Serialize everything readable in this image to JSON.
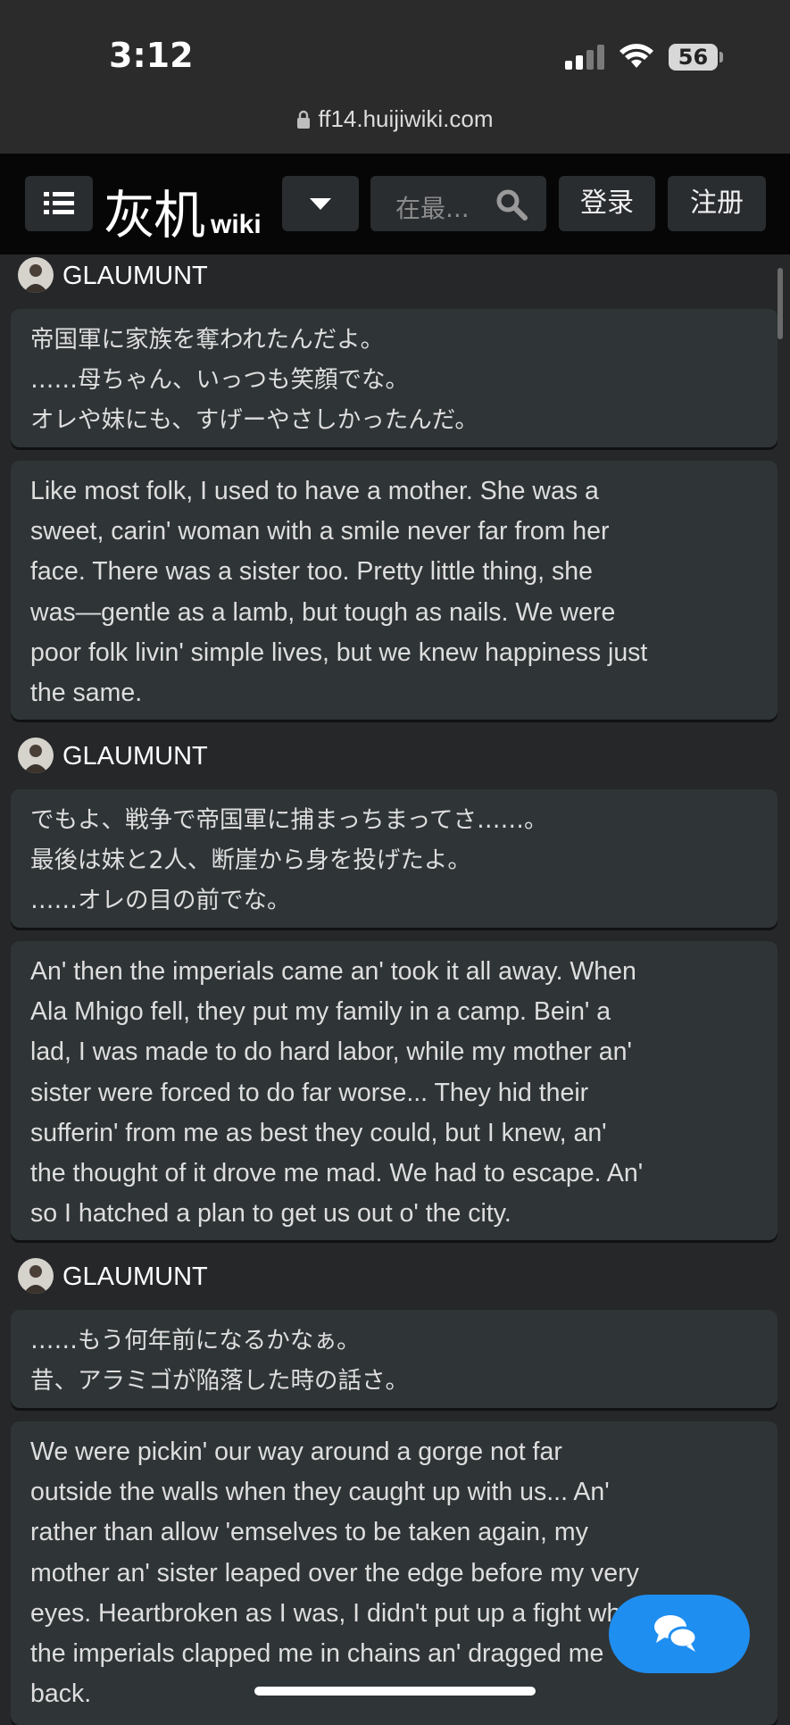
{
  "status": {
    "time": "3:12",
    "battery": "56",
    "url": "ff14.huijiwiki.com"
  },
  "header": {
    "logo_cn": "灰机",
    "logo_wiki": "wiki",
    "search_placeholder": "在最...",
    "login_label": "登录",
    "register_label": "注册"
  },
  "dialogue": [
    {
      "speaker": "GLAUMUNT",
      "jp_lines": [
        "帝国軍に家族を奪われたんだよ。",
        "……母ちゃん、いっつも笑顔でな。",
        "オレや妹にも、すげーやさしかったんだ。"
      ],
      "en_lines": [
        "Like most folk, I used to have a mother. She was a",
        "sweet, carin' woman with a smile never far from her",
        "face. There was a sister too. Pretty little thing, she",
        "was—gentle as a lamb, but tough as nails. We were",
        "poor folk livin' simple lives, but we knew happiness just",
        "the same."
      ]
    },
    {
      "speaker": "GLAUMUNT",
      "jp_lines": [
        "でもよ、戦争で帝国軍に捕まっちまってさ……。",
        "最後は妹と2人、断崖から身を投げたよ。",
        "……オレの目の前でな。"
      ],
      "en_lines": [
        "An' then the imperials came an' took it all away. When",
        "Ala Mhigo fell, they put my family in a camp. Bein' a",
        "lad, I was made to do hard labor, while my mother an'",
        "sister were forced to do far worse... They hid their",
        "sufferin' from me as best they could, but I knew, an'",
        "the thought of it drove me mad. We had to escape. An'",
        "so I hatched a plan to get us out o' the city."
      ]
    },
    {
      "speaker": "GLAUMUNT",
      "jp_lines": [
        "……もう何年前になるかなぁ。",
        "昔、アラミゴが陥落した時の話さ。"
      ],
      "en_lines": [
        "We were pickin' our way around a gorge not far",
        "outside the walls when they caught up with us... An'",
        "rather than allow 'emselves to be taken again, my",
        "mother an' sister leaped over the edge before my very",
        "eyes. Heartbroken as I was, I didn't put up a fight when",
        "the imperials clapped me in chains an' dragged me",
        "back."
      ]
    }
  ]
}
